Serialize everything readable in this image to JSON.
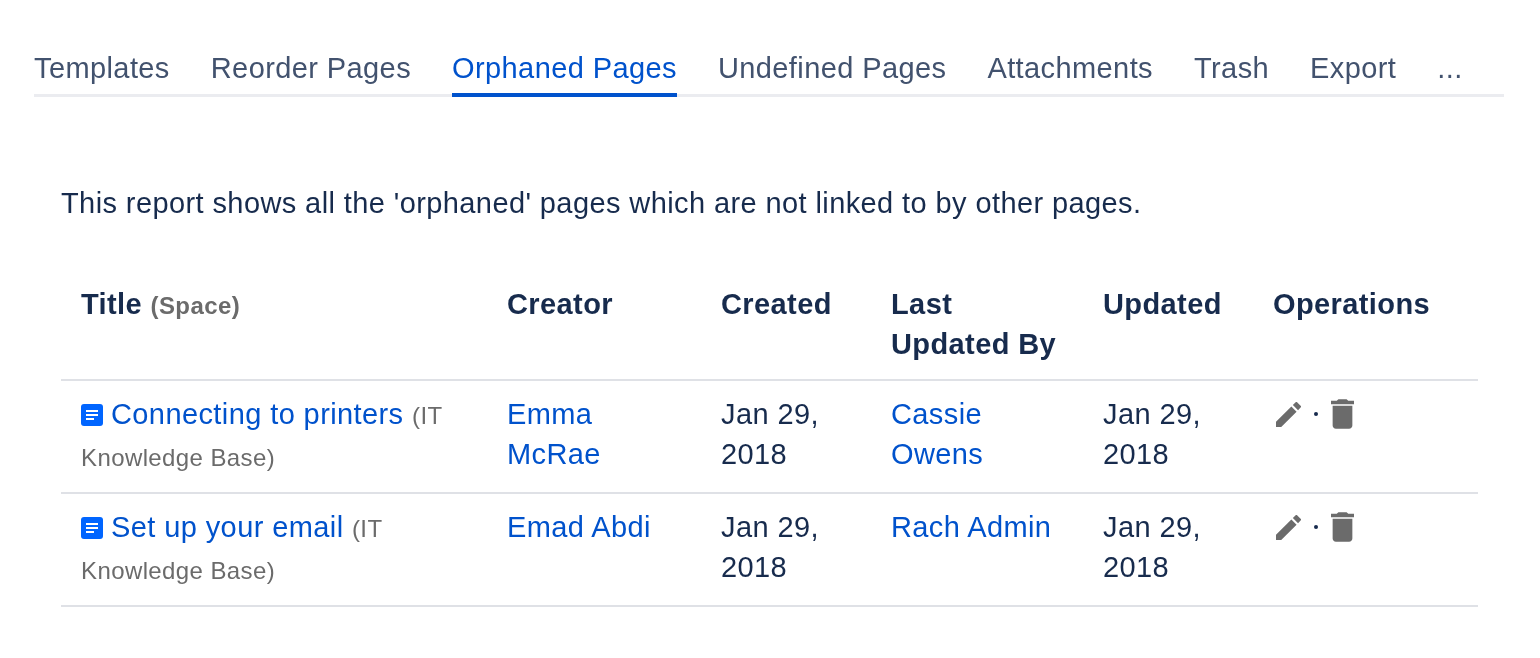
{
  "tabs": [
    {
      "label": "Templates",
      "selected": false
    },
    {
      "label": "Reorder Pages",
      "selected": false
    },
    {
      "label": "Orphaned Pages",
      "selected": true
    },
    {
      "label": "Undefined Pages",
      "selected": false
    },
    {
      "label": "Attachments",
      "selected": false
    },
    {
      "label": "Trash",
      "selected": false
    },
    {
      "label": "Export",
      "selected": false
    },
    {
      "label": "...",
      "selected": false
    }
  ],
  "description": "This report shows all the 'orphaned' pages which are not linked to by other pages.",
  "table": {
    "columns": [
      {
        "label": "Title",
        "note": "(Space)"
      },
      {
        "label": "Creator"
      },
      {
        "label": "Created"
      },
      {
        "label": "Last Updated By"
      },
      {
        "label": "Updated"
      },
      {
        "label": "Operations"
      }
    ],
    "rows": [
      {
        "title": "Connecting to printers",
        "space": "(IT Knowledge Base)",
        "creator": "Emma McRae",
        "created": "Jan 29, 2018",
        "last_updated_by": "Cassie Owens",
        "updated": "Jan 29, 2018"
      },
      {
        "title": "Set up your email",
        "space": "(IT Knowledge Base)",
        "creator": "Emad Abdi",
        "created": "Jan 29, 2018",
        "last_updated_by": "Rach Admin",
        "updated": "Jan 29, 2018"
      }
    ]
  }
}
